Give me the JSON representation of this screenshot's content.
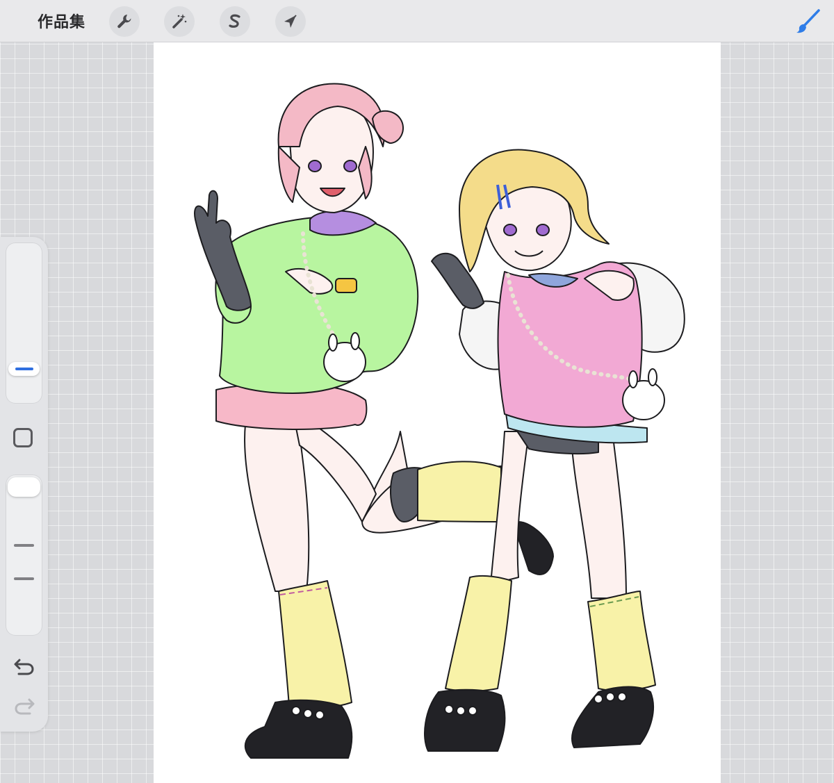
{
  "toolbar": {
    "gallery_label": "作品集",
    "tools": [
      {
        "name": "actions",
        "icon": "wrench-icon"
      },
      {
        "name": "adjustments",
        "icon": "magic-wand-icon"
      },
      {
        "name": "selection",
        "icon": "selection-s-icon"
      },
      {
        "name": "transform",
        "icon": "arrow-cursor-icon"
      }
    ],
    "active_tool": {
      "name": "brush",
      "icon": "brush-icon",
      "color": "#2f7de8"
    }
  },
  "sidebar": {
    "brush_size_slider": {
      "level": 0.2
    },
    "modify_button": {
      "icon": "square-icon"
    },
    "opacity_slider": {
      "level": 1.0
    },
    "undo": {
      "icon": "undo-arrow-icon"
    },
    "redo": {
      "icon": "redo-arrow-icon",
      "enabled": false
    }
  },
  "canvas": {
    "background": "#ffffff",
    "content": "artwork",
    "palette": {
      "pink_hair": "#f4b9c6",
      "blonde_hair": "#f4dc8a",
      "green_sweater": "#b8f5a0",
      "pink_vest": "#f2a9d4",
      "pink_skirt": "#f7b8c8",
      "yellow_legwarmers": "#f8f2a8",
      "black_shoes": "#222226",
      "gray_gloves": "#5a5d66",
      "blue_skirt": "#bde6f0",
      "white_sleeves": "#f5f5f5"
    }
  }
}
